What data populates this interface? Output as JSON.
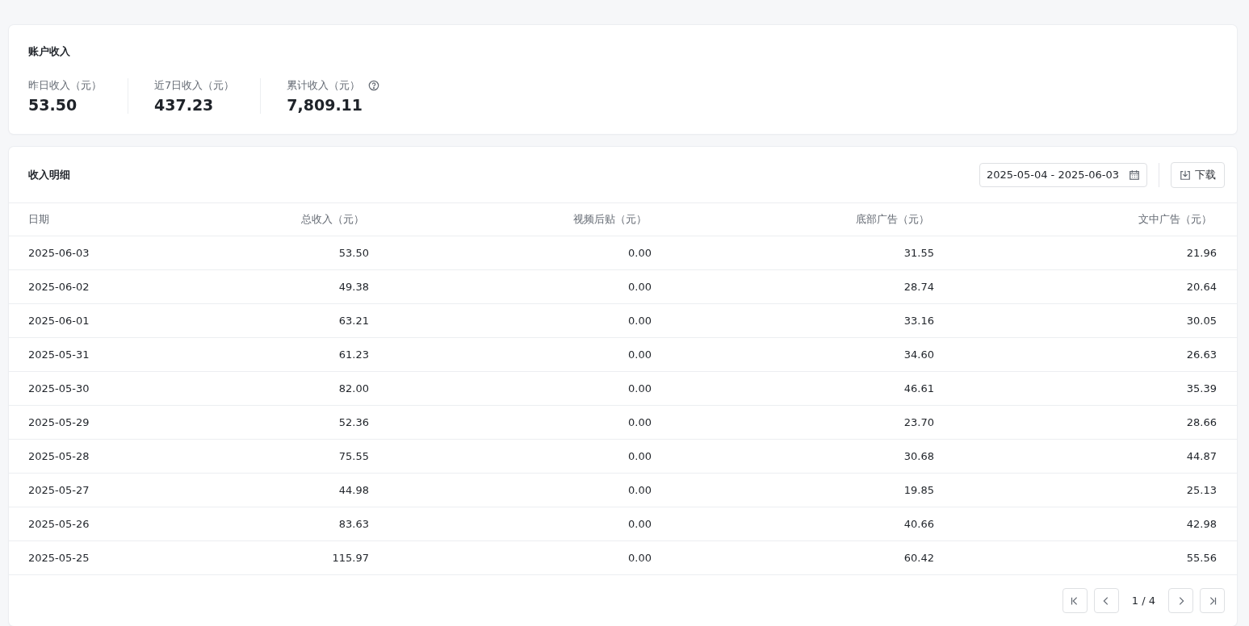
{
  "summary": {
    "title": "账户收入",
    "stats": [
      {
        "label": "昨日收入（元）",
        "value": "53.50",
        "help": false
      },
      {
        "label": "近7日收入（元）",
        "value": "437.23",
        "help": false
      },
      {
        "label": "累计收入（元）",
        "value": "7,809.11",
        "help": true
      }
    ]
  },
  "details": {
    "title": "收入明细",
    "date_range": "2025-05-04 - 2025-06-03",
    "download": "下载",
    "columns": [
      "日期",
      "总收入（元）",
      "视频后贴（元）",
      "底部广告（元）",
      "文中广告（元）"
    ],
    "rows": [
      [
        "2025-06-03",
        "53.50",
        "0.00",
        "31.55",
        "21.96"
      ],
      [
        "2025-06-02",
        "49.38",
        "0.00",
        "28.74",
        "20.64"
      ],
      [
        "2025-06-01",
        "63.21",
        "0.00",
        "33.16",
        "30.05"
      ],
      [
        "2025-05-31",
        "61.23",
        "0.00",
        "34.60",
        "26.63"
      ],
      [
        "2025-05-30",
        "82.00",
        "0.00",
        "46.61",
        "35.39"
      ],
      [
        "2025-05-29",
        "52.36",
        "0.00",
        "23.70",
        "28.66"
      ],
      [
        "2025-05-28",
        "75.55",
        "0.00",
        "30.68",
        "44.87"
      ],
      [
        "2025-05-27",
        "44.98",
        "0.00",
        "19.85",
        "25.13"
      ],
      [
        "2025-05-26",
        "83.63",
        "0.00",
        "40.66",
        "42.98"
      ],
      [
        "2025-05-25",
        "115.97",
        "0.00",
        "60.42",
        "55.56"
      ]
    ],
    "pagination": {
      "page": "1 / 4"
    }
  }
}
